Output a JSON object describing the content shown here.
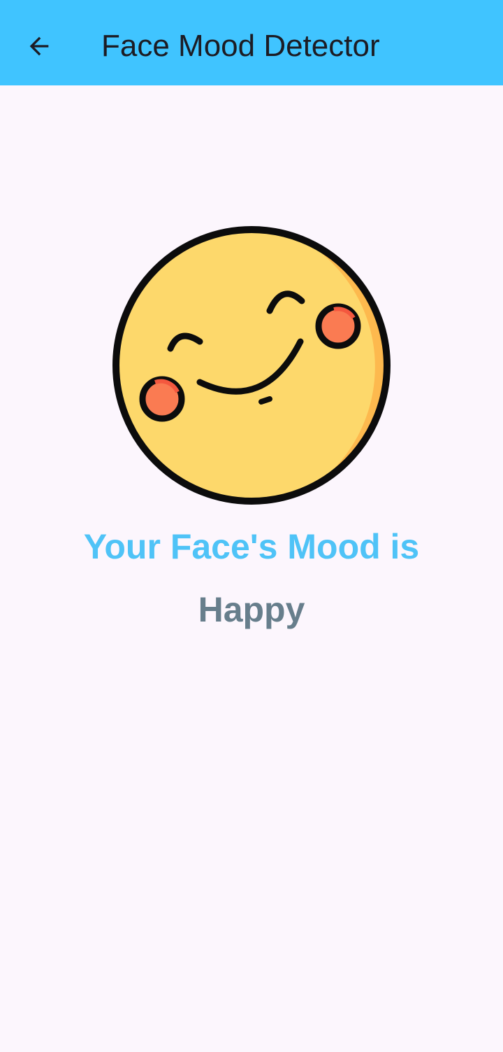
{
  "app_bar": {
    "title": "Face Mood Detector",
    "back_icon": "arrow-back-icon",
    "background_color": "#40c4ff"
  },
  "main": {
    "emoji_icon": "smiling-face-emoji-icon",
    "heading": "Your Face's Mood is",
    "mood": "Happy",
    "heading_color": "#4fc3f7",
    "mood_color": "#677e8c"
  }
}
